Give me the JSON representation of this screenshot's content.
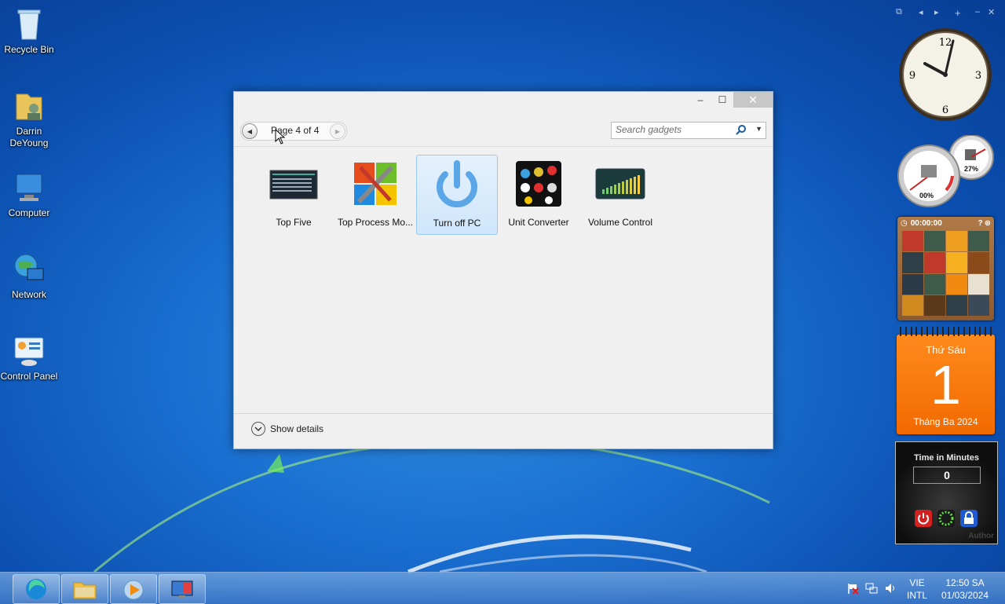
{
  "desktop": {
    "icons": [
      {
        "label": "Recycle Bin"
      },
      {
        "label": "Darrin DeYoung"
      },
      {
        "label": "Computer"
      },
      {
        "label": "Network"
      },
      {
        "label": "Control Panel"
      }
    ]
  },
  "window": {
    "minimize": "–",
    "maximize": "☐",
    "close": "✕",
    "pager_label": "Page 4 of 4",
    "search_placeholder": "Search gadgets",
    "gadgets": [
      {
        "name": "Top Five",
        "selected": false
      },
      {
        "name": "Top Process Mo...",
        "selected": false
      },
      {
        "name": "Turn off PC",
        "selected": true
      },
      {
        "name": "Unit Converter",
        "selected": false
      },
      {
        "name": "Volume Control",
        "selected": false
      }
    ],
    "show_details": "Show details",
    "thumb_text": {
      "top_five": "Top 5 - Processor",
      "volume": "Volume 100%"
    }
  },
  "sidebar": {
    "meter_cpu": "00%",
    "meter_mem": "27%",
    "puzzle_time": "00:00:00",
    "calendar": {
      "day_name": "Thứ Sáu",
      "day": "1",
      "month_year": "Tháng Ba 2024"
    },
    "timer": {
      "label": "Time in Minutes",
      "value": "0",
      "author": "Author"
    }
  },
  "taskbar": {
    "lang_top": "VIE",
    "lang_bottom": "INTL",
    "time": "12:50 SA",
    "date": "01/03/2024"
  },
  "colors": {
    "accent": "#1a6fd0",
    "calendar": "#f26a00"
  }
}
